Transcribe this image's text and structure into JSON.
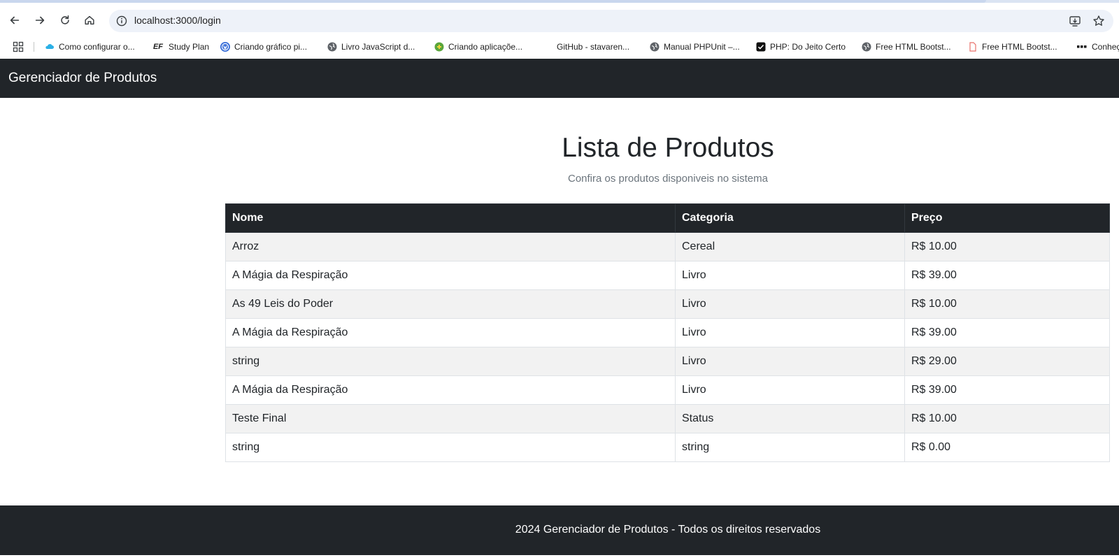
{
  "browser": {
    "url": "localhost:3000/login",
    "bookmarks": [
      {
        "label": "Como configurar o...",
        "icon": "cloud-icon"
      },
      {
        "label": "Study Plan",
        "icon": "ef-logo-icon"
      },
      {
        "label": "Criando gráfico pi...",
        "icon": "wordpress-icon"
      },
      {
        "label": "Livro JavaScript d...",
        "icon": "globe-icon"
      },
      {
        "label": "Criando aplicaçõe...",
        "icon": "green-logo-icon"
      },
      {
        "label": "GitHub - stavaren...",
        "icon": "github-icon"
      },
      {
        "label": "Manual PHPUnit –...",
        "icon": "globe-icon"
      },
      {
        "label": "PHP: Do Jeito Certo",
        "icon": "checkbox-icon"
      },
      {
        "label": "Free HTML Bootst...",
        "icon": "globe-icon"
      },
      {
        "label": "Free HTML Bootst...",
        "icon": "document-icon"
      },
      {
        "label": "Conheç",
        "icon": "dots-icon"
      }
    ]
  },
  "header": {
    "brand": "Gerenciador de Produtos"
  },
  "main": {
    "title": "Lista de Produtos",
    "subtitle": "Confira os produtos disponiveis no sistema",
    "table": {
      "columns": [
        "Nome",
        "Categoria",
        "Preço"
      ],
      "rows": [
        [
          "Arroz",
          "Cereal",
          "R$ 10.00"
        ],
        [
          "A Mágia da Respiração",
          "Livro",
          "R$ 39.00"
        ],
        [
          "As 49 Leis do Poder",
          "Livro",
          "R$ 10.00"
        ],
        [
          "A Mágia da Respiração",
          "Livro",
          "R$ 39.00"
        ],
        [
          "string",
          "Livro",
          "R$ 29.00"
        ],
        [
          "A Mágia da Respiração",
          "Livro",
          "R$ 39.00"
        ],
        [
          "Teste Final",
          "Status",
          "R$ 10.00"
        ],
        [
          "string",
          "string",
          "R$ 0.00"
        ]
      ]
    }
  },
  "footer": {
    "text": "2024 Gerenciador de Produtos - Todos os direitos reservados"
  },
  "colors": {
    "dark": "#212529",
    "stripe": "#f2f2f2",
    "muted": "#6c757d"
  }
}
